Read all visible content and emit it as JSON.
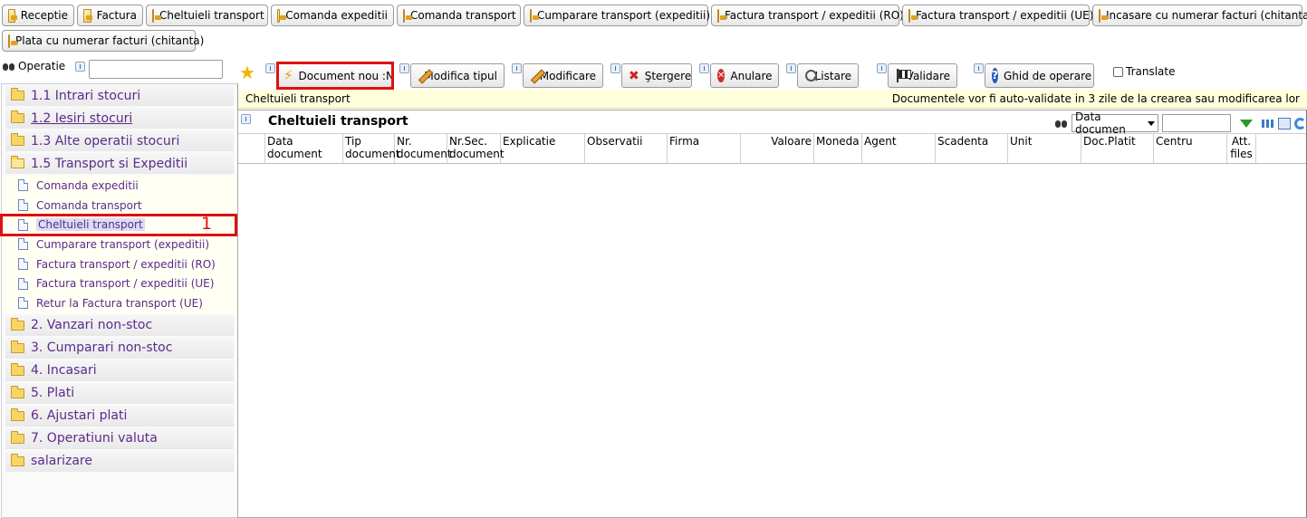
{
  "top_tabs": [
    "Receptie",
    "Factura",
    "Cheltuieli transport",
    "Comanda expeditii",
    "Comanda transport",
    "Cumparare transport (expeditii)",
    "Factura transport / expeditii (RO)",
    "Factura transport / expeditii (UE)",
    "Incasare cu numerar facturi (chitanta)",
    "Plata cu numerar facturi (chitanta)"
  ],
  "operation_search": {
    "label": "Operatie",
    "value": ""
  },
  "tree": {
    "folders_top": [
      "1.1 Intrari stocuri",
      "1.2 Iesiri stocuri",
      "1.3 Alte operatii stocuri",
      "1.5 Transport si Expeditii"
    ],
    "leaves": [
      "Comanda expeditii",
      "Comanda transport",
      "Cheltuieli transport",
      "Cumparare transport (expeditii)",
      "Factura transport / expeditii (RO)",
      "Factura transport / expeditii (UE)",
      "Retur la Factura transport (UE)"
    ],
    "folders_bottom": [
      "2. Vanzari non-stoc",
      "3. Cumparari non-stoc",
      "4. Incasari",
      "5. Plati",
      "6. Ajustari plati",
      "7. Operatiuni valuta",
      "salarizare"
    ],
    "marker": "1"
  },
  "toolbar": {
    "new_doc": "Document nou :N",
    "change_type": "Modifica tipul",
    "modify": "Modificare",
    "delete": "Ştergere",
    "cancel": "Anulare",
    "list": "Listare",
    "validate": "Validare",
    "guide": "Ghid de operare",
    "translate": "Translate"
  },
  "info_bar": {
    "left": "Cheltuieli transport",
    "right": "Documentele vor fi auto-validate in 3 zile de la crearea sau modificarea lor"
  },
  "grid": {
    "title": "Cheltuieli transport",
    "search_field": "Data documen",
    "search_value": "",
    "columns": [
      "Data document",
      "Tip document",
      "Nr. document",
      "Nr.Sec. document",
      "Explicatie",
      "Observatii",
      "Firma",
      "Valoare",
      "Moneda",
      "Agent",
      "Scadenta",
      "Unit",
      "Doc.Platit",
      "Centru",
      "Att. files"
    ]
  },
  "colors": {
    "highlight": "#e01010",
    "link": "#5a2a8c",
    "info_bg": "#ffffdc"
  }
}
